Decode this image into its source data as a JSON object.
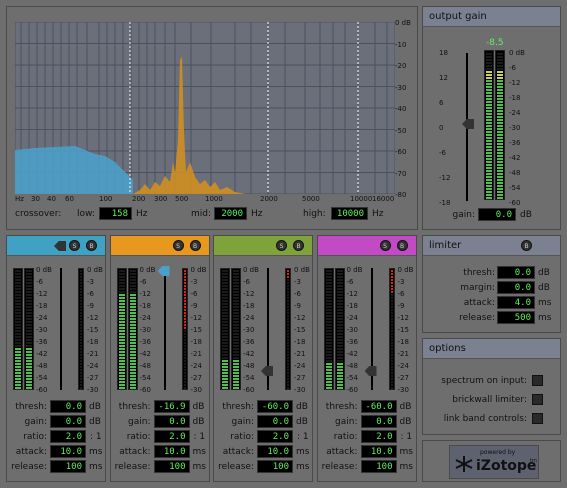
{
  "spectrum": {
    "db_labels": [
      "0 dB",
      "-10",
      "-20",
      "-30",
      "-40",
      "-50",
      "-60",
      "-70",
      "-80"
    ],
    "freq_labels": [
      "Hz",
      "30",
      "40",
      "60",
      "100",
      "200",
      "300",
      "500",
      "1000",
      "2000",
      "5000",
      "10000",
      "16000"
    ],
    "crossover_label": "crossover:",
    "low_label": "low:",
    "low_value": "158",
    "mid_label": "mid:",
    "mid_value": "2000",
    "high_label": "high:",
    "high_value": "10000",
    "hz": "Hz"
  },
  "output_gain": {
    "title": "output gain",
    "peak": "-8.5",
    "slider_scale": [
      "18",
      "12",
      "6",
      "0",
      "-6",
      "-12",
      "-18"
    ],
    "meter_scale": [
      "0 dB",
      "-6",
      "-12",
      "-18",
      "-24",
      "-30",
      "-36",
      "-42",
      "-48",
      "-54",
      "-60"
    ],
    "gain_label": "gain:",
    "gain_value": "0.0",
    "unit": "dB"
  },
  "bands": [
    {
      "color": "#3fa2c4",
      "thresh": "0.0",
      "gain": "0.0",
      "ratio": "2.0",
      "attack": "10.0",
      "release": "100"
    },
    {
      "color": "#e8981f",
      "thresh": "-16.9",
      "gain": "0.0",
      "ratio": "2.0",
      "attack": "10.0",
      "release": "100"
    },
    {
      "color": "#7fa33a",
      "thresh": "-60.0",
      "gain": "0.0",
      "ratio": "2.0",
      "attack": "10.0",
      "release": "100"
    },
    {
      "color": "#c24ac4",
      "thresh": "-60.0",
      "gain": "0.0",
      "ratio": "2.0",
      "attack": "10.0",
      "release": "100"
    }
  ],
  "band_labels": {
    "thresh": "thresh:",
    "gain": "gain:",
    "ratio": "ratio:",
    "attack": "attack:",
    "release": "release:",
    "db": "dB",
    "ratio_unit": ": 1",
    "ms": "ms",
    "s": "S",
    "b": "B"
  },
  "band_meter_scale": [
    "0 dB",
    "-6",
    "-12",
    "-18",
    "-24",
    "-30",
    "-36",
    "-42",
    "-48",
    "-54",
    "-60"
  ],
  "band_gr_scale": [
    "0 dB",
    "-3",
    "-6",
    "-9",
    "-12",
    "-15",
    "-18",
    "-21",
    "-24",
    "-27",
    "-30"
  ],
  "limiter": {
    "title": "limiter",
    "b": "B",
    "thresh_label": "thresh:",
    "thresh_value": "0.0",
    "margin_label": "margin:",
    "margin_value": "0.0",
    "attack_label": "attack:",
    "attack_value": "4.0",
    "release_label": "release:",
    "release_value": "500",
    "db": "dB",
    "ms": "ms"
  },
  "options": {
    "title": "options",
    "spectrum": "spectrum on input:",
    "brickwall": "brickwall limiter:",
    "link": "link band controls:"
  },
  "logo": {
    "powered": "powered by",
    "brand": "iZotope",
    "tm": "tm"
  }
}
